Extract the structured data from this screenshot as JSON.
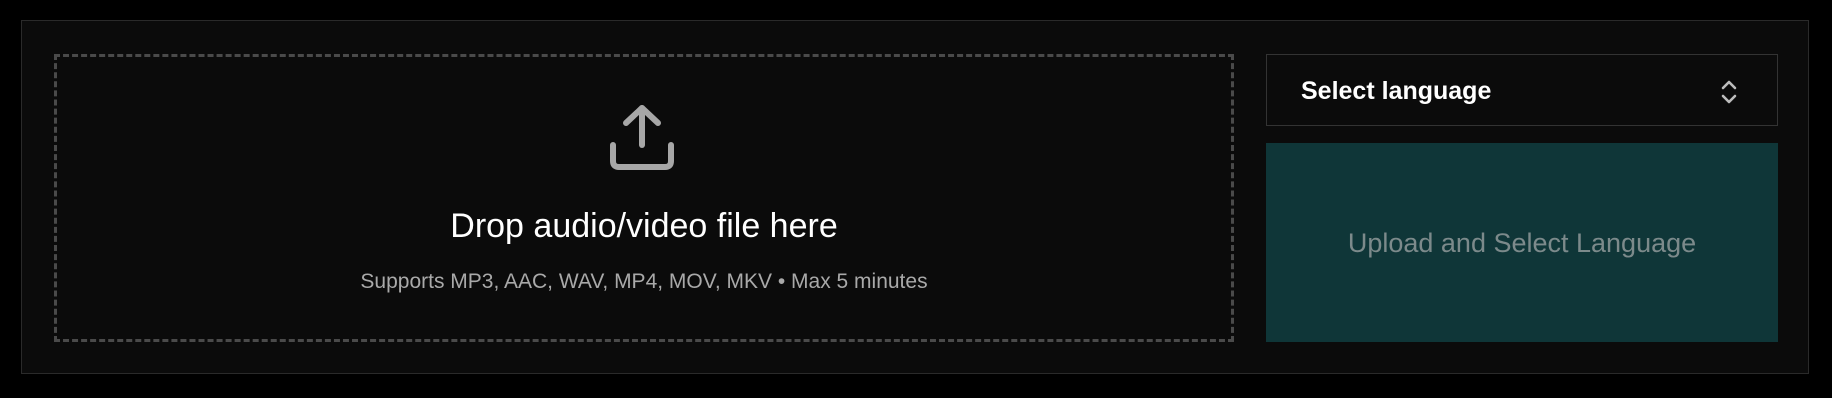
{
  "dropzone": {
    "icon": "upload-icon",
    "title": "Drop audio/video file here",
    "subtitle": "Supports MP3, AAC, WAV, MP4, MOV, MKV • Max 5 minutes"
  },
  "language_select": {
    "selected_value": "Select language",
    "icon": "chevron-up-down-icon"
  },
  "upload_button": {
    "label": "Upload and Select Language",
    "state": "disabled"
  },
  "colors": {
    "background": "#000000",
    "panel": "#0b0b0b",
    "button_bg": "#0f3638",
    "button_text": "#7c8a8b"
  }
}
